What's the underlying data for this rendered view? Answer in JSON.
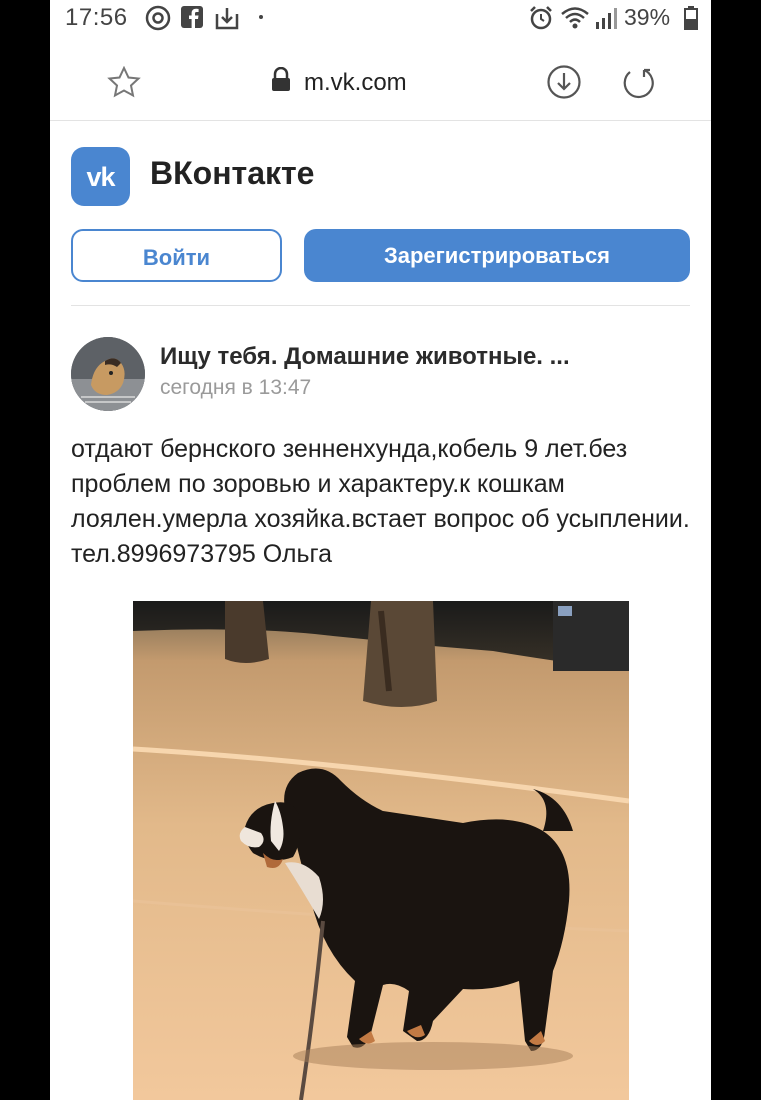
{
  "status": {
    "time": "17:56",
    "battery": "39%"
  },
  "browser": {
    "url": "m.vk.com"
  },
  "header": {
    "brand": "ВКонтакте",
    "logo_text": "vk"
  },
  "auth": {
    "login_label": "Войти",
    "register_label": "Зарегистрироваться"
  },
  "post": {
    "author": "Ищу тебя. Домашние животные. ...",
    "time": "сегодня в 13:47",
    "text": "отдают бернского зенненхунда,кобель 9 лет.без проблем по зоровью и характеру.к кошкам лоялен.умерла хозяйка.встает вопрос об усыплении. тел.8996973795 Ольга"
  },
  "colors": {
    "accent": "#4a86d0",
    "text": "#222222",
    "muted": "#9a9a9a"
  },
  "icons": [
    "at-icon",
    "facebook-icon",
    "download-icon",
    "alarm-icon",
    "wifi-icon",
    "signal-icon",
    "battery-icon",
    "star-icon",
    "lock-icon",
    "download-circle-icon",
    "reload-icon"
  ]
}
